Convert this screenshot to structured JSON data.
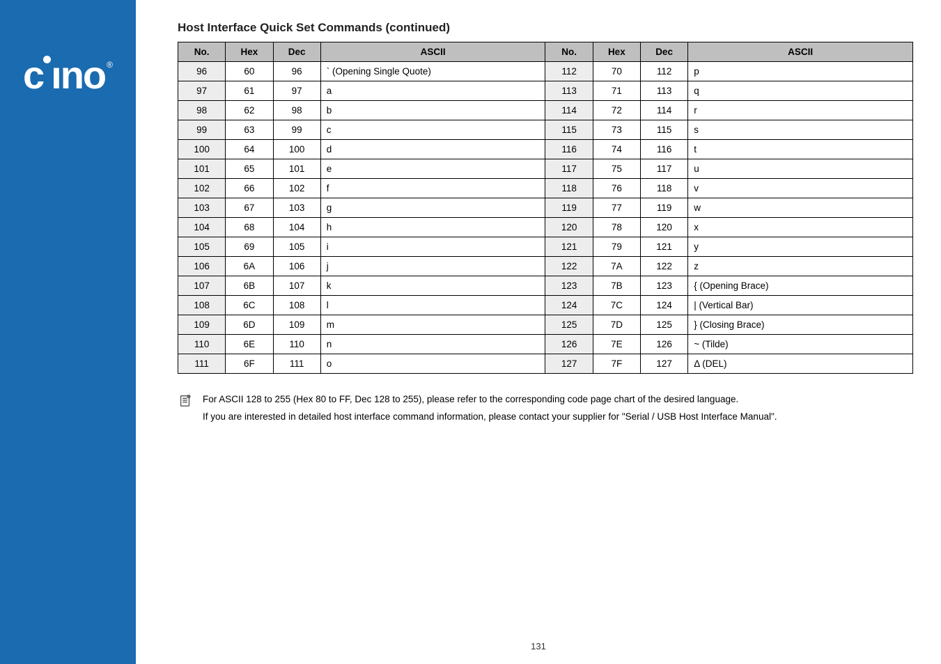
{
  "logo": {
    "text": "cino",
    "reg": "®"
  },
  "table": {
    "title": "Host Interface Quick Set Commands (continued)",
    "headers": [
      "No.",
      "Hex",
      "Dec",
      "ASCII",
      "No.",
      "Hex",
      "Dec",
      "ASCII"
    ],
    "rows": [
      [
        "96",
        "60",
        "96",
        "` (Opening Single Quote)",
        "112",
        "70",
        "112",
        "p"
      ],
      [
        "97",
        "61",
        "97",
        "a",
        "113",
        "71",
        "113",
        "q"
      ],
      [
        "98",
        "62",
        "98",
        "b",
        "114",
        "72",
        "114",
        "r"
      ],
      [
        "99",
        "63",
        "99",
        "c",
        "115",
        "73",
        "115",
        "s"
      ],
      [
        "100",
        "64",
        "100",
        "d",
        "116",
        "74",
        "116",
        "t"
      ],
      [
        "101",
        "65",
        "101",
        "e",
        "117",
        "75",
        "117",
        "u"
      ],
      [
        "102",
        "66",
        "102",
        "f",
        "118",
        "76",
        "118",
        "v"
      ],
      [
        "103",
        "67",
        "103",
        "g",
        "119",
        "77",
        "119",
        "w"
      ],
      [
        "104",
        "68",
        "104",
        "h",
        "120",
        "78",
        "120",
        "x"
      ],
      [
        "105",
        "69",
        "105",
        "i",
        "121",
        "79",
        "121",
        "y"
      ],
      [
        "106",
        "6A",
        "106",
        "j",
        "122",
        "7A",
        "122",
        "z"
      ],
      [
        "107",
        "6B",
        "107",
        "k",
        "123",
        "7B",
        "123",
        "{ (Opening Brace)"
      ],
      [
        "108",
        "6C",
        "108",
        "l",
        "124",
        "7C",
        "124",
        "| (Vertical Bar)"
      ],
      [
        "109",
        "6D",
        "109",
        "m",
        "125",
        "7D",
        "125",
        "} (Closing Brace)"
      ],
      [
        "110",
        "6E",
        "110",
        "n",
        "126",
        "7E",
        "126",
        "~ (Tilde)"
      ],
      [
        "111",
        "6F",
        "111",
        "o",
        "127",
        "7F",
        "127",
        "Δ (DEL)"
      ]
    ]
  },
  "notes": [
    "For ASCII 128 to 255 (Hex 80 to FF, Dec 128 to 255), please refer to the corresponding code page chart of the desired language.",
    "If you are interested in detailed host interface command information, please contact your supplier for \"Serial / USB Host Interface Manual\"."
  ],
  "pageNumber": "131"
}
